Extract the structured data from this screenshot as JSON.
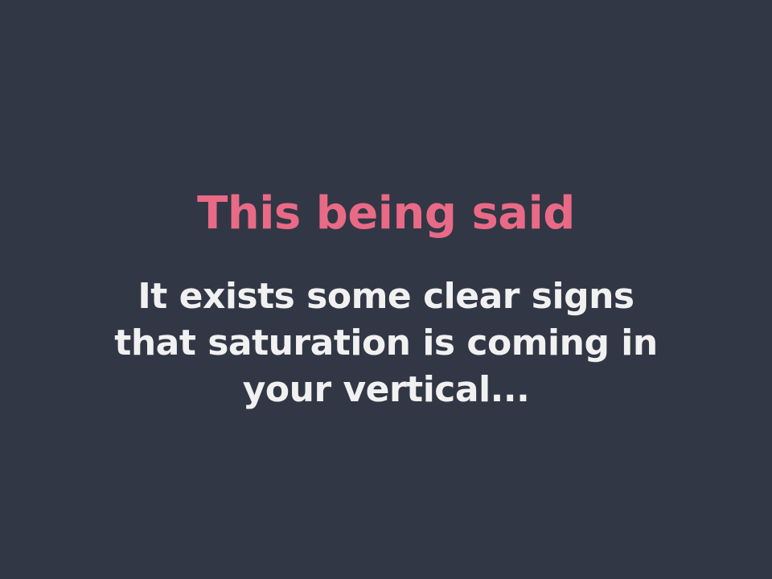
{
  "slide": {
    "title": "This being said",
    "body_lines": [
      "It exists some clear signs",
      "that saturation is coming in",
      "your vertical..."
    ]
  },
  "colors": {
    "background": "#323745",
    "title": "#e96a86",
    "body": "#f1f1f1"
  }
}
